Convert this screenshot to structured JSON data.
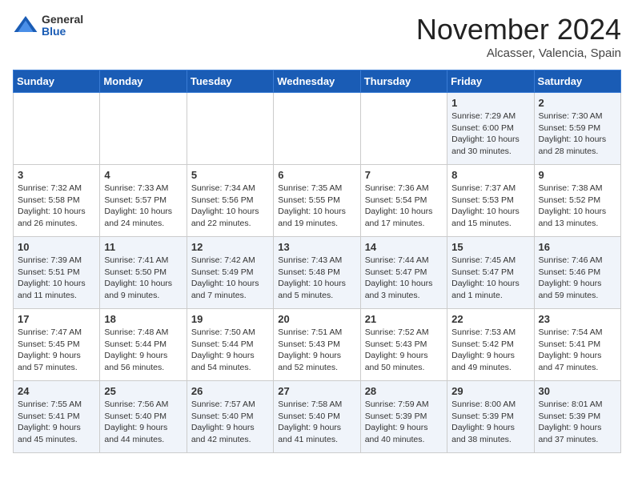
{
  "logo": {
    "general": "General",
    "blue": "Blue"
  },
  "header": {
    "month": "November 2024",
    "location": "Alcasser, Valencia, Spain"
  },
  "weekdays": [
    "Sunday",
    "Monday",
    "Tuesday",
    "Wednesday",
    "Thursday",
    "Friday",
    "Saturday"
  ],
  "weeks": [
    [
      {
        "day": "",
        "info": ""
      },
      {
        "day": "",
        "info": ""
      },
      {
        "day": "",
        "info": ""
      },
      {
        "day": "",
        "info": ""
      },
      {
        "day": "",
        "info": ""
      },
      {
        "day": "1",
        "info": "Sunrise: 7:29 AM\nSunset: 6:00 PM\nDaylight: 10 hours\nand 30 minutes."
      },
      {
        "day": "2",
        "info": "Sunrise: 7:30 AM\nSunset: 5:59 PM\nDaylight: 10 hours\nand 28 minutes."
      }
    ],
    [
      {
        "day": "3",
        "info": "Sunrise: 7:32 AM\nSunset: 5:58 PM\nDaylight: 10 hours\nand 26 minutes."
      },
      {
        "day": "4",
        "info": "Sunrise: 7:33 AM\nSunset: 5:57 PM\nDaylight: 10 hours\nand 24 minutes."
      },
      {
        "day": "5",
        "info": "Sunrise: 7:34 AM\nSunset: 5:56 PM\nDaylight: 10 hours\nand 22 minutes."
      },
      {
        "day": "6",
        "info": "Sunrise: 7:35 AM\nSunset: 5:55 PM\nDaylight: 10 hours\nand 19 minutes."
      },
      {
        "day": "7",
        "info": "Sunrise: 7:36 AM\nSunset: 5:54 PM\nDaylight: 10 hours\nand 17 minutes."
      },
      {
        "day": "8",
        "info": "Sunrise: 7:37 AM\nSunset: 5:53 PM\nDaylight: 10 hours\nand 15 minutes."
      },
      {
        "day": "9",
        "info": "Sunrise: 7:38 AM\nSunset: 5:52 PM\nDaylight: 10 hours\nand 13 minutes."
      }
    ],
    [
      {
        "day": "10",
        "info": "Sunrise: 7:39 AM\nSunset: 5:51 PM\nDaylight: 10 hours\nand 11 minutes."
      },
      {
        "day": "11",
        "info": "Sunrise: 7:41 AM\nSunset: 5:50 PM\nDaylight: 10 hours\nand 9 minutes."
      },
      {
        "day": "12",
        "info": "Sunrise: 7:42 AM\nSunset: 5:49 PM\nDaylight: 10 hours\nand 7 minutes."
      },
      {
        "day": "13",
        "info": "Sunrise: 7:43 AM\nSunset: 5:48 PM\nDaylight: 10 hours\nand 5 minutes."
      },
      {
        "day": "14",
        "info": "Sunrise: 7:44 AM\nSunset: 5:47 PM\nDaylight: 10 hours\nand 3 minutes."
      },
      {
        "day": "15",
        "info": "Sunrise: 7:45 AM\nSunset: 5:47 PM\nDaylight: 10 hours\nand 1 minute."
      },
      {
        "day": "16",
        "info": "Sunrise: 7:46 AM\nSunset: 5:46 PM\nDaylight: 9 hours\nand 59 minutes."
      }
    ],
    [
      {
        "day": "17",
        "info": "Sunrise: 7:47 AM\nSunset: 5:45 PM\nDaylight: 9 hours\nand 57 minutes."
      },
      {
        "day": "18",
        "info": "Sunrise: 7:48 AM\nSunset: 5:44 PM\nDaylight: 9 hours\nand 56 minutes."
      },
      {
        "day": "19",
        "info": "Sunrise: 7:50 AM\nSunset: 5:44 PM\nDaylight: 9 hours\nand 54 minutes."
      },
      {
        "day": "20",
        "info": "Sunrise: 7:51 AM\nSunset: 5:43 PM\nDaylight: 9 hours\nand 52 minutes."
      },
      {
        "day": "21",
        "info": "Sunrise: 7:52 AM\nSunset: 5:43 PM\nDaylight: 9 hours\nand 50 minutes."
      },
      {
        "day": "22",
        "info": "Sunrise: 7:53 AM\nSunset: 5:42 PM\nDaylight: 9 hours\nand 49 minutes."
      },
      {
        "day": "23",
        "info": "Sunrise: 7:54 AM\nSunset: 5:41 PM\nDaylight: 9 hours\nand 47 minutes."
      }
    ],
    [
      {
        "day": "24",
        "info": "Sunrise: 7:55 AM\nSunset: 5:41 PM\nDaylight: 9 hours\nand 45 minutes."
      },
      {
        "day": "25",
        "info": "Sunrise: 7:56 AM\nSunset: 5:40 PM\nDaylight: 9 hours\nand 44 minutes."
      },
      {
        "day": "26",
        "info": "Sunrise: 7:57 AM\nSunset: 5:40 PM\nDaylight: 9 hours\nand 42 minutes."
      },
      {
        "day": "27",
        "info": "Sunrise: 7:58 AM\nSunset: 5:40 PM\nDaylight: 9 hours\nand 41 minutes."
      },
      {
        "day": "28",
        "info": "Sunrise: 7:59 AM\nSunset: 5:39 PM\nDaylight: 9 hours\nand 40 minutes."
      },
      {
        "day": "29",
        "info": "Sunrise: 8:00 AM\nSunset: 5:39 PM\nDaylight: 9 hours\nand 38 minutes."
      },
      {
        "day": "30",
        "info": "Sunrise: 8:01 AM\nSunset: 5:39 PM\nDaylight: 9 hours\nand 37 minutes."
      }
    ]
  ]
}
